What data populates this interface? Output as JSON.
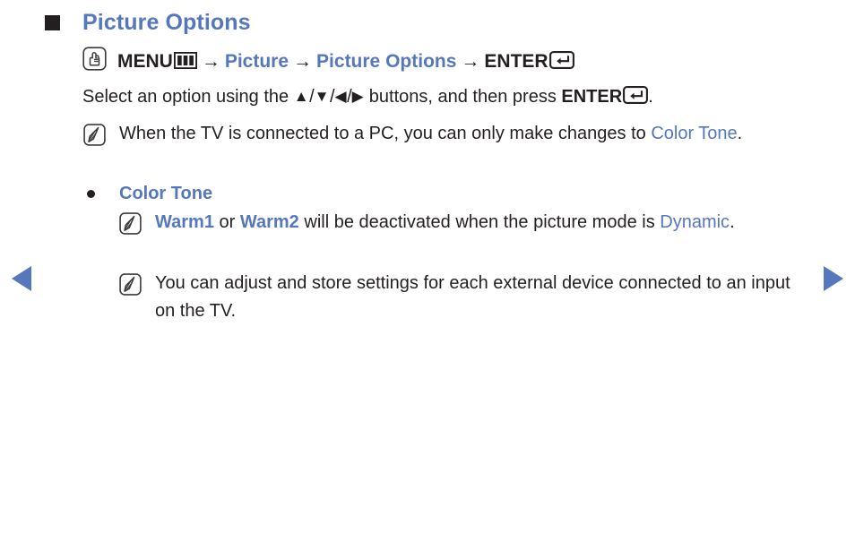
{
  "document": {
    "type": "tv-user-manual-page",
    "background_color": "#ffffff",
    "accent_color": "#5577bb",
    "text_color": "#231f20"
  },
  "navigation": {
    "prev_label": "previous page",
    "next_label": "next page",
    "arrow_color": "#5577bb"
  },
  "heading": {
    "bullet": "square-bullet",
    "title": "Picture Options"
  },
  "menu_path": {
    "icon": "hand-press-button-icon",
    "menu_label": "MENU",
    "menu_glyph": "menu-key-icon",
    "arrow": "→",
    "step1": "Picture",
    "step2": "Picture Options",
    "enter_label": "ENTER",
    "enter_glyph": "enter-key-icon"
  },
  "instruction": {
    "before": "Select an option using the ",
    "up": "▲",
    "sep1": "/",
    "down": "▼",
    "sep2": "/",
    "left": "◀",
    "sep3": "/",
    "right": "▶",
    "middle": " buttons, and then press ",
    "enter_label": "ENTER",
    "enter_glyph": "enter-key-icon",
    "after": "."
  },
  "notes": [
    {
      "icon": "note-pencil-icon",
      "segments": [
        {
          "text": "When the TV is connected to a PC, you can only make changes to ",
          "style": "normal"
        },
        {
          "text": "Color Tone",
          "style": "blue"
        },
        {
          "text": ".",
          "style": "normal"
        }
      ]
    }
  ],
  "option": {
    "bullet": "round-bullet",
    "label": "Color Tone",
    "sub_notes": [
      {
        "icon": "note-pencil-icon",
        "segments": [
          {
            "text": "Warm1",
            "style": "blue-bold"
          },
          {
            "text": " or ",
            "style": "normal"
          },
          {
            "text": "Warm2",
            "style": "blue-bold"
          },
          {
            "text": " will be deactivated when the picture mode is ",
            "style": "normal"
          },
          {
            "text": "Dynamic",
            "style": "blue"
          },
          {
            "text": ".",
            "style": "normal"
          }
        ]
      },
      {
        "icon": "note-pencil-icon",
        "segments": [
          {
            "text": "You can adjust and store settings for each external device connected to an input on the TV.",
            "style": "normal"
          }
        ]
      }
    ]
  }
}
